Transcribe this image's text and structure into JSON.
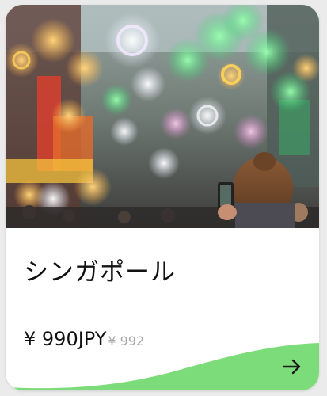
{
  "card": {
    "image_alt_icon": "city-street-photo",
    "title": "シンガポール",
    "price": "¥ 990JPY",
    "original_price": "¥ 992",
    "accent_color": "#7ddc7a",
    "action_icon": "arrow-right-icon"
  }
}
